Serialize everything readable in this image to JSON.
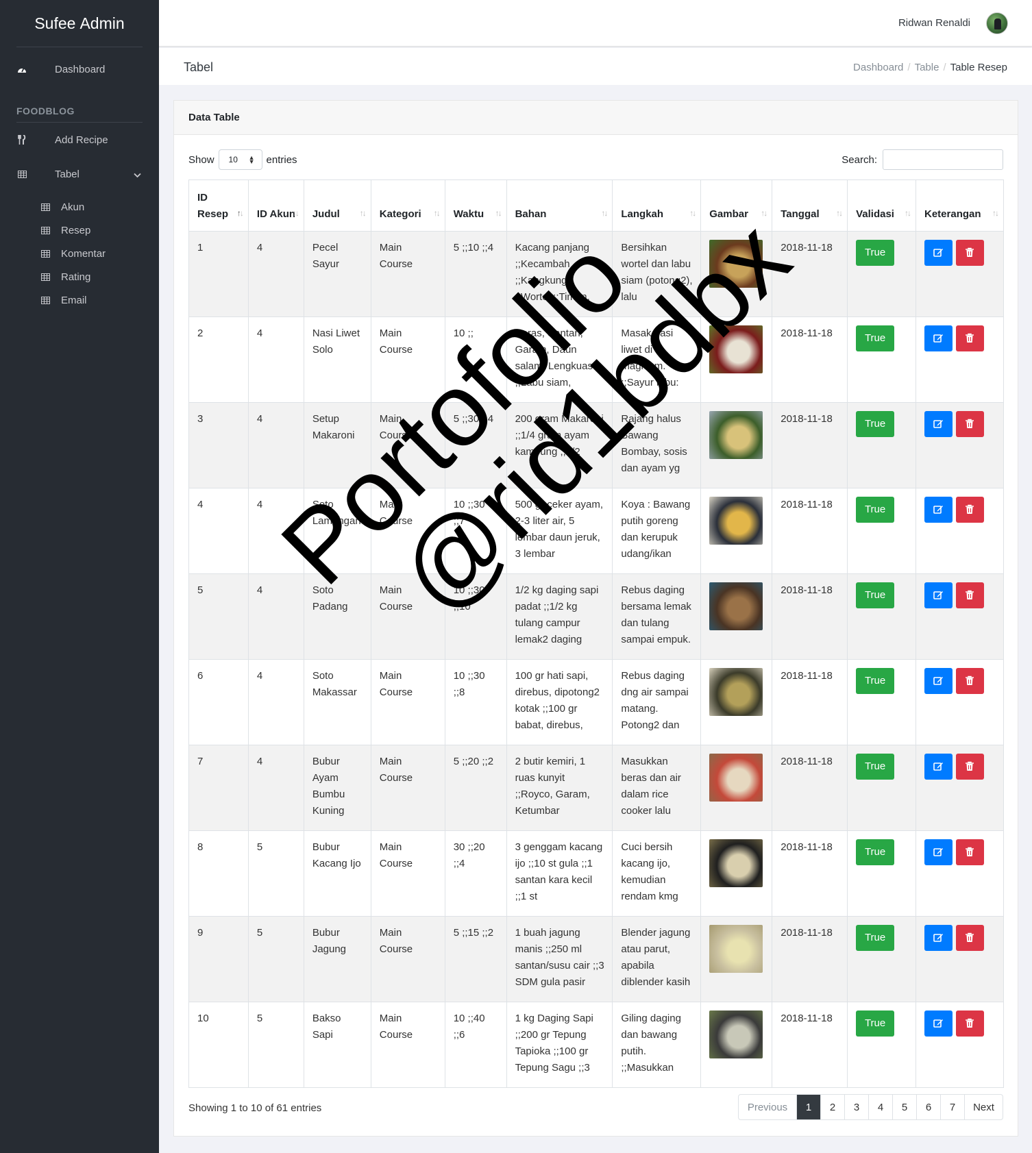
{
  "brand": {
    "part1": "Sufee",
    "part2": "Admin"
  },
  "sidebar": {
    "dashboard": "Dashboard",
    "section_title": "FOODBLOG",
    "add_recipe": "Add Recipe",
    "tabel": "Tabel",
    "sub_items": [
      "Akun",
      "Resep",
      "Komentar",
      "Rating",
      "Email"
    ]
  },
  "header": {
    "user_name": "Ridwan Renaldi"
  },
  "page": {
    "title": "Tabel",
    "breadcrumb": [
      "Dashboard",
      "Table",
      "Table Resep"
    ]
  },
  "card": {
    "title": "Data Table",
    "show_label": "Show",
    "entries_label": "entries",
    "entries_value": "10",
    "search_label": "Search:"
  },
  "table": {
    "headers": [
      "ID Resep",
      "ID Akun",
      "Judul",
      "Kategori",
      "Waktu",
      "Bahan",
      "Langkah",
      "Gambar",
      "Tanggal",
      "Validasi",
      "Keterangan"
    ],
    "rows": [
      {
        "id": "1",
        "akun": "4",
        "judul": "Pecel Sayur",
        "kategori": "Main Course",
        "waktu": "5 ;;10 ;;4",
        "bahan": "Kacang panjang ;;Kecambah ;;Kangkung ;;Wortel ;;Timun,",
        "langkah": "Bersihkan wortel dan labu siam (potong2), lalu",
        "tanggal": "2018-11-18",
        "validasi": "True"
      },
      {
        "id": "2",
        "akun": "4",
        "judul": "Nasi Liwet Solo",
        "kategori": "Main Course",
        "waktu": "10 ;;",
        "bahan": "Beras, Santan, Garam, Daun salam, Lengkuas ;;Labu siam,",
        "langkah": "Masak nasi liwet di magicom. ;;Sayur labu:",
        "tanggal": "2018-11-18",
        "validasi": "True"
      },
      {
        "id": "3",
        "akun": "4",
        "judul": "Setup Makaroni",
        "kategori": "Main Course",
        "waktu": "5 ;;30 ;;4",
        "bahan": "200 gram Makaroni ;;1/4 gram ayam kampung ;;1/2",
        "langkah": "Rajang halus Bawang Bombay, sosis dan ayam yg",
        "tanggal": "2018-11-18",
        "validasi": "True"
      },
      {
        "id": "4",
        "akun": "4",
        "judul": "Soto Lamongan",
        "kategori": "Main Course",
        "waktu": "10 ;;30 ;;7",
        "bahan": "500 gr ceker ayam, 2-3 liter air, 5 lembar daun jeruk, 3 lembar",
        "langkah": "Koya : Bawang putih goreng dan kerupuk udang/ikan",
        "tanggal": "2018-11-18",
        "validasi": "True"
      },
      {
        "id": "5",
        "akun": "4",
        "judul": "Soto Padang",
        "kategori": "Main Course",
        "waktu": "10 ;;30 ;;10",
        "bahan": "1/2 kg daging sapi padat ;;1/2 kg tulang campur lemak2 daging",
        "langkah": "Rebus daging bersama lemak dan tulang sampai empuk.",
        "tanggal": "2018-11-18",
        "validasi": "True"
      },
      {
        "id": "6",
        "akun": "4",
        "judul": "Soto Makassar",
        "kategori": "Main Course",
        "waktu": "10 ;;30 ;;8",
        "bahan": "100 gr hati sapi, direbus, dipotong2 kotak ;;100 gr babat, direbus,",
        "langkah": "Rebus daging dng air sampai matang. Potong2 dan",
        "tanggal": "2018-11-18",
        "validasi": "True"
      },
      {
        "id": "7",
        "akun": "4",
        "judul": "Bubur Ayam Bumbu Kuning",
        "kategori": "Main Course",
        "waktu": "5 ;;20 ;;2",
        "bahan": "2 butir kemiri, 1 ruas kunyit ;;Royco, Garam, Ketumbar",
        "langkah": "Masukkan beras dan air dalam rice cooker lalu",
        "tanggal": "2018-11-18",
        "validasi": "True"
      },
      {
        "id": "8",
        "akun": "5",
        "judul": "Bubur Kacang Ijo",
        "kategori": "Main Course",
        "waktu": "30 ;;20 ;;4",
        "bahan": "3 genggam kacang ijo ;;10 st gula ;;1 santan kara kecil ;;1 st",
        "langkah": "Cuci bersih kacang ijo, kemudian rendam kmg",
        "tanggal": "2018-11-18",
        "validasi": "True"
      },
      {
        "id": "9",
        "akun": "5",
        "judul": "Bubur Jagung",
        "kategori": "Main Course",
        "waktu": "5 ;;15 ;;2",
        "bahan": "1 buah jagung manis ;;250 ml santan/susu cair ;;3 SDM gula pasir",
        "langkah": "Blender jagung atau parut, apabila diblender kasih",
        "tanggal": "2018-11-18",
        "validasi": "True"
      },
      {
        "id": "10",
        "akun": "5",
        "judul": "Bakso Sapi",
        "kategori": "Main Course",
        "waktu": "10 ;;40 ;;6",
        "bahan": "1 kg Daging Sapi ;;200 gr Tepung Tapioka ;;100 gr Tepung Sagu ;;3",
        "langkah": "Giling daging dan bawang putih. ;;Masukkan",
        "tanggal": "2018-11-18",
        "validasi": "True"
      }
    ]
  },
  "footer": {
    "info": "Showing 1 to 10 of 61 entries",
    "previous": "Previous",
    "pages": [
      "1",
      "2",
      "3",
      "4",
      "5",
      "6",
      "7"
    ],
    "next": "Next"
  },
  "watermark": {
    "line1": "Portofolio",
    "line2": "@rid1bdbx"
  },
  "colors": {
    "sidebar": "#272c33",
    "true_button": "#28a745",
    "edit_button": "#007bff",
    "delete_button": "#dc3545",
    "active_page": "#343a40"
  }
}
